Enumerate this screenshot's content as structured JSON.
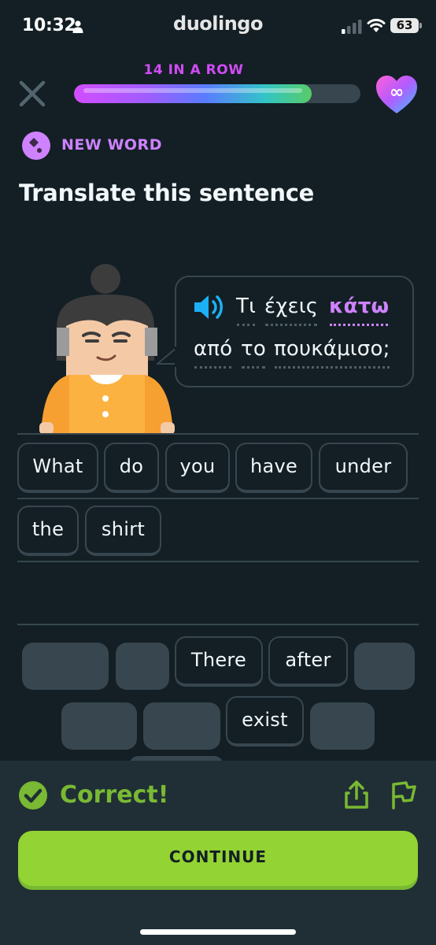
{
  "status_bar": {
    "time": "10:32",
    "app_name": "duolingo",
    "battery": "63",
    "icons": [
      "person-icon",
      "signal-icon",
      "wifi-icon",
      "battery-icon"
    ]
  },
  "header": {
    "streak_label": "14 IN A ROW",
    "progress_fraction": 0.83,
    "hearts": "∞",
    "colors": {
      "streak": "#d14bf5",
      "track": "#37464f"
    }
  },
  "lesson": {
    "badge_label": "NEW WORD",
    "title": "Translate this sentence",
    "sentence_words": [
      {
        "text": "Τι",
        "highlight": false
      },
      {
        "text": "έχεις",
        "highlight": false
      },
      {
        "text": "κάτω",
        "highlight": true
      },
      {
        "text": "από",
        "highlight": false
      },
      {
        "text": "το",
        "highlight": false
      },
      {
        "text": "πουκάμισο;",
        "highlight": false
      }
    ],
    "answer_words": [
      "What",
      "do",
      "you",
      "have",
      "under",
      "the",
      "shirt"
    ],
    "bank_words": [
      "There",
      "after",
      "exist"
    ]
  },
  "footer": {
    "status": "Correct!",
    "continue_label": "CONTINUE",
    "colors": {
      "accent": "#79b933",
      "button": "#93d333",
      "background": "#202f36"
    }
  }
}
